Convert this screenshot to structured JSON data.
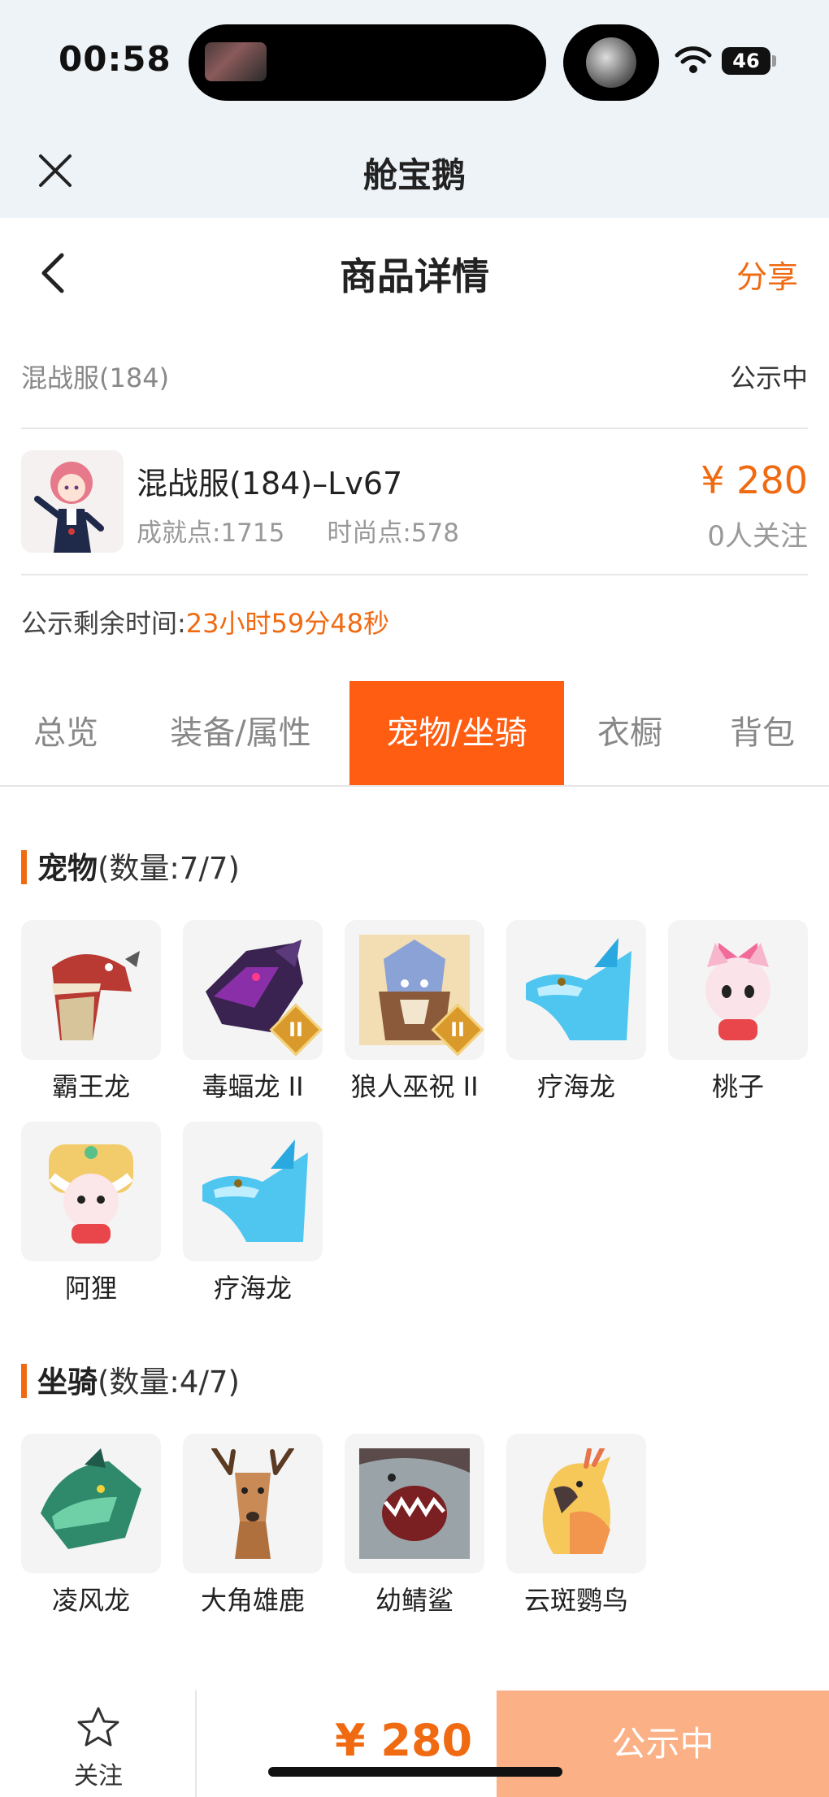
{
  "status_bar": {
    "time": "00:58",
    "battery": "46"
  },
  "mini_program": {
    "title": "舱宝鹅"
  },
  "header": {
    "title": "商品详情",
    "share_label": "分享"
  },
  "server": {
    "name": "混战服(184)",
    "status": "公示中"
  },
  "product": {
    "name": "混战服(184)–Lv67",
    "achievement": "成就点:1715",
    "fashion": "时尚点:578",
    "price": "¥ 280",
    "followers": "0人关注"
  },
  "countdown": {
    "label": "公示剩余时间:",
    "value": "23小时59分48秒"
  },
  "tabs": [
    {
      "label": "总览"
    },
    {
      "label": "装备/属性"
    },
    {
      "label": "宠物/坐骑"
    },
    {
      "label": "衣橱"
    },
    {
      "label": "背包"
    }
  ],
  "active_tab": "宠物/坐骑",
  "pets": {
    "title": "宠物",
    "count": "(数量:7/7)",
    "items": [
      {
        "label": "霸王龙",
        "icon": "t-rex-icon"
      },
      {
        "label": "毒蝠龙 II",
        "icon": "poison-bat-dragon-icon",
        "badge": "II"
      },
      {
        "label": "狼人巫祝 II",
        "icon": "werewolf-shaman-icon",
        "badge": "II"
      },
      {
        "label": "疗海龙",
        "icon": "sea-dragon-icon"
      },
      {
        "label": "桃子",
        "icon": "peach-cat-icon"
      },
      {
        "label": "阿狸",
        "icon": "ali-fox-icon"
      },
      {
        "label": "疗海龙",
        "icon": "sea-dragon-icon"
      }
    ]
  },
  "mounts": {
    "title": "坐骑",
    "count": "(数量:4/7)",
    "items": [
      {
        "label": "凌风龙",
        "icon": "wind-dragon-icon"
      },
      {
        "label": "大角雄鹿",
        "icon": "great-stag-icon"
      },
      {
        "label": "幼鲭鲨",
        "icon": "young-shark-icon"
      },
      {
        "label": "云斑鹦鸟",
        "icon": "cloud-parrot-icon"
      }
    ]
  },
  "bottom_bar": {
    "follow_label": "关注",
    "price": "¥ 280",
    "action_label": "公示中"
  },
  "colors": {
    "accent": "#f06a12",
    "tab_active": "#ff5d12",
    "action_button": "#fbb086"
  }
}
